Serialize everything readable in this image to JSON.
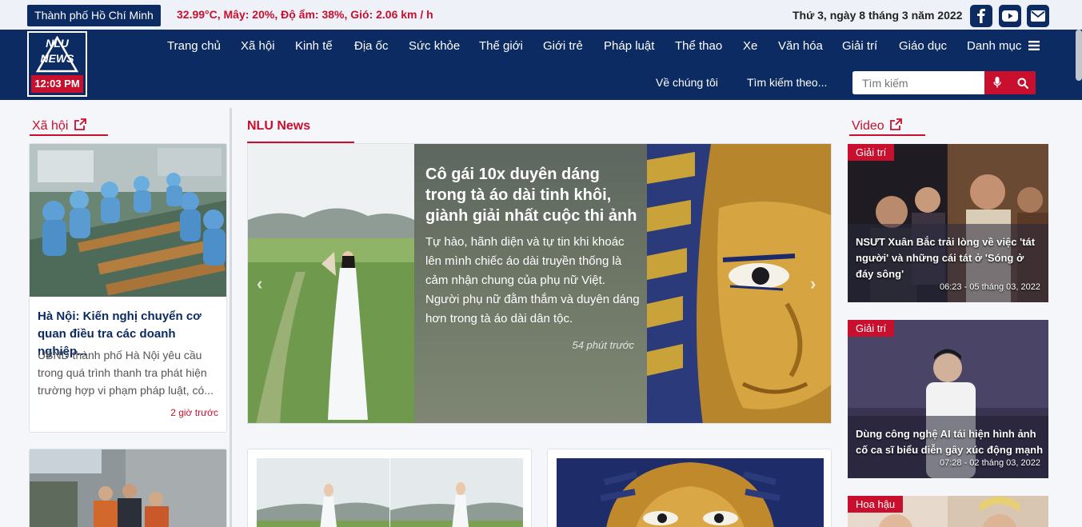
{
  "topbar": {
    "city": "Thành phố Hồ Chí Minh",
    "weather": "32.99°C, Mây: 20%, Độ ẩm: 38%, Gió: 2.06 km / h",
    "date": "Thứ 3, ngày 8 tháng 3 năm 2022",
    "social": [
      "facebook-icon",
      "youtube-icon",
      "mail-icon"
    ]
  },
  "logo": {
    "line1": "NLU",
    "line2": "NEWS",
    "clock": "12:03 PM"
  },
  "nav": {
    "items": [
      "Trang chủ",
      "Xã hội",
      "Kinh tế",
      "Địa ốc",
      "Sức khỏe",
      "Thế giới",
      "Giới trẻ",
      "Pháp luật",
      "Thể thao",
      "Xe",
      "Văn hóa",
      "Giải trí",
      "Giáo dục",
      "Danh mục"
    ],
    "about": "Về chúng tôi",
    "search_by": "Tìm kiếm theo...",
    "search_placeholder": "Tìm kiếm"
  },
  "left": {
    "heading": "Xã hội",
    "card1": {
      "title": "Hà Nội: Kiến nghị chuyển cơ quan điều tra các doanh nghiệp...",
      "desc": "UBND thành phố Hà Nội yêu cầu trong quá trình thanh tra phát hiện trường hợp vi phạm pháp luật, có...",
      "time": "2 giờ trước"
    }
  },
  "main": {
    "heading": "NLU News",
    "slide": {
      "title": "Cô gái 10x duyên dáng trong tà áo dài tinh khôi, giành giải nhất cuộc thi ảnh",
      "desc": "Tự hào, hãnh diện và tự tin khi khoác lên mình chiếc áo dài truyền thống là cảm nhận chung của phụ nữ Việt. Người phụ nữ đằm thắm và duyên dáng hơn trong tà áo dài dân tộc.",
      "time": "54 phút trước"
    }
  },
  "video": {
    "heading": "Video",
    "items": [
      {
        "tag": "Giải trí",
        "caption": "NSƯT Xuân Bắc trải lòng về việc 'tát người' và những cái tát ở 'Sóng ở đáy sông'",
        "time": "06:23 - 05 tháng 03, 2022"
      },
      {
        "tag": "Giải trí",
        "caption": "Dùng công nghệ AI tái hiện hình ảnh cố ca sĩ biểu diễn gây xúc động mạnh",
        "time": "07:28 - 02 tháng 03, 2022"
      },
      {
        "tag": "Hoa hậu"
      }
    ]
  },
  "colors": {
    "primary": "#0b2b62",
    "accent": "#c8102e"
  }
}
